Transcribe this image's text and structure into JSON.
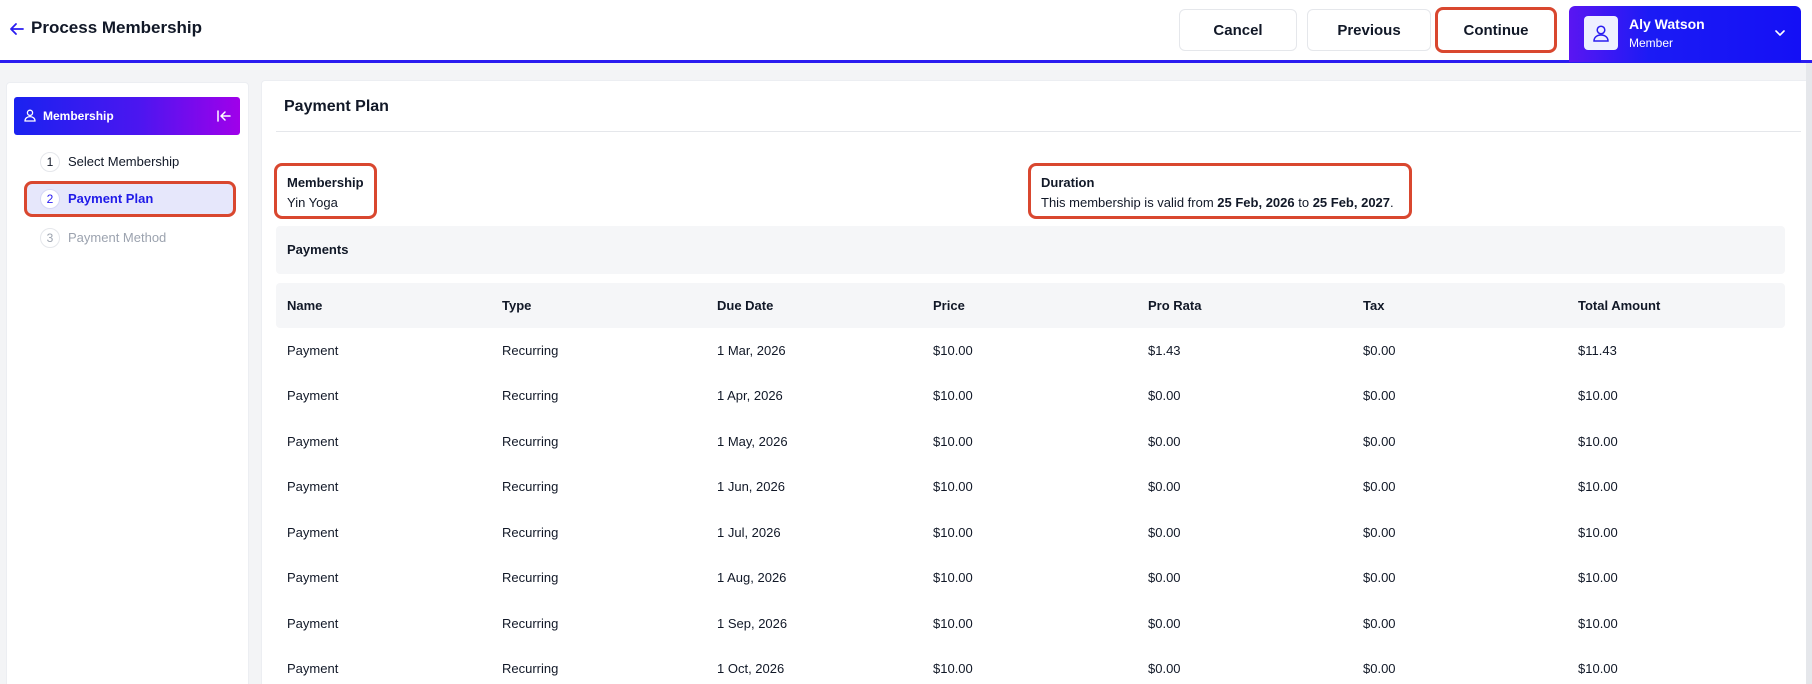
{
  "header": {
    "title": "Process Membership",
    "cancel_label": "Cancel",
    "previous_label": "Previous",
    "continue_label": "Continue",
    "user": {
      "name": "Aly Watson",
      "role": "Member"
    }
  },
  "sidebar": {
    "title": "Membership",
    "steps": [
      {
        "number": "1",
        "label": "Select Membership"
      },
      {
        "number": "2",
        "label": "Payment Plan"
      },
      {
        "number": "3",
        "label": "Payment Method"
      }
    ]
  },
  "main": {
    "title": "Payment Plan",
    "membership": {
      "label": "Membership",
      "value": "Yin Yoga"
    },
    "duration": {
      "label": "Duration",
      "prefix": "This membership is valid from ",
      "start": "25 Feb, 2026",
      "middle": " to ",
      "end": "25 Feb, 2027",
      "suffix": "."
    },
    "payments_title": "Payments",
    "table": {
      "columns": [
        "Name",
        "Type",
        "Due Date",
        "Price",
        "Pro Rata",
        "Tax",
        "Total Amount"
      ],
      "rows": [
        [
          "Payment",
          "Recurring",
          "1 Mar, 2026",
          "$10.00",
          "$1.43",
          "$0.00",
          "$11.43"
        ],
        [
          "Payment",
          "Recurring",
          "1 Apr, 2026",
          "$10.00",
          "$0.00",
          "$0.00",
          "$10.00"
        ],
        [
          "Payment",
          "Recurring",
          "1 May, 2026",
          "$10.00",
          "$0.00",
          "$0.00",
          "$10.00"
        ],
        [
          "Payment",
          "Recurring",
          "1 Jun, 2026",
          "$10.00",
          "$0.00",
          "$0.00",
          "$10.00"
        ],
        [
          "Payment",
          "Recurring",
          "1 Jul, 2026",
          "$10.00",
          "$0.00",
          "$0.00",
          "$10.00"
        ],
        [
          "Payment",
          "Recurring",
          "1 Aug, 2026",
          "$10.00",
          "$0.00",
          "$0.00",
          "$10.00"
        ],
        [
          "Payment",
          "Recurring",
          "1 Sep, 2026",
          "$10.00",
          "$0.00",
          "$0.00",
          "$10.00"
        ],
        [
          "Payment",
          "Recurring",
          "1 Oct, 2026",
          "$10.00",
          "$0.00",
          "$0.00",
          "$10.00"
        ]
      ]
    }
  },
  "colors": {
    "accent": "#2a1cf0",
    "gradient_violet": "#a000ea",
    "highlight_border": "#d9472f",
    "active_step_bg": "#e6e7fb"
  },
  "icons": {
    "back": "arrow-left-icon",
    "user": "user-icon",
    "chevron": "chevron-down-icon",
    "collapse": "collapse-left-icon"
  }
}
